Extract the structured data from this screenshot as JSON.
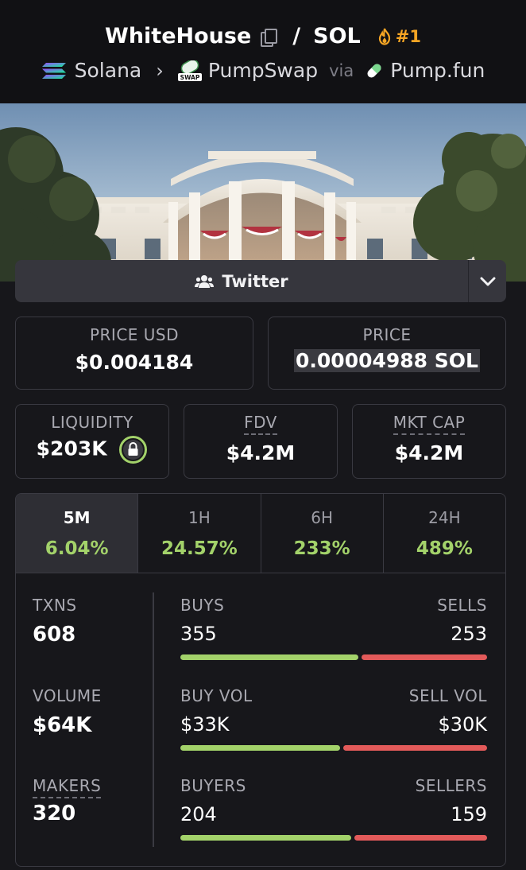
{
  "header": {
    "token_name": "WhiteHouse",
    "separator": "/",
    "quote": "SOL",
    "rank": "#1",
    "chain": "Solana",
    "dex": "PumpSwap",
    "via": "via",
    "launchpad": "Pump.fun"
  },
  "social": {
    "label": "Twitter"
  },
  "price": {
    "usd_label": "PRICE USD",
    "usd_value": "$0.004184",
    "native_label": "PRICE",
    "native_value": "0.00004988 SOL"
  },
  "metrics": {
    "liquidity_label": "LIQUIDITY",
    "liquidity_value": "$203K",
    "fdv_label": "FDV",
    "fdv_value": "$4.2M",
    "mktcap_label": "MKT CAP",
    "mktcap_value": "$4.2M"
  },
  "tabs": [
    {
      "label": "5M",
      "value": "6.04%",
      "active": true
    },
    {
      "label": "1H",
      "value": "24.57%"
    },
    {
      "label": "6H",
      "value": "233%"
    },
    {
      "label": "24H",
      "value": "489%"
    }
  ],
  "stats": {
    "txns_label": "TXNS",
    "txns_value": "608",
    "volume_label": "VOLUME",
    "volume_value": "$64K",
    "makers_label": "MAKERS",
    "makers_value": "320",
    "buys_label": "BUYS",
    "buys_value": "355",
    "sells_label": "SELLS",
    "sells_value": "253",
    "buyvol_label": "BUY VOL",
    "buyvol_value": "$33K",
    "sellvol_label": "SELL VOL",
    "sellvol_value": "$30K",
    "buyers_label": "BUYERS",
    "buyers_value": "204",
    "sellers_label": "SELLERS",
    "sellers_value": "159"
  },
  "colors": {
    "positive": "#a3d26a",
    "negative": "#e35a5a",
    "rank": "#f5a524"
  }
}
